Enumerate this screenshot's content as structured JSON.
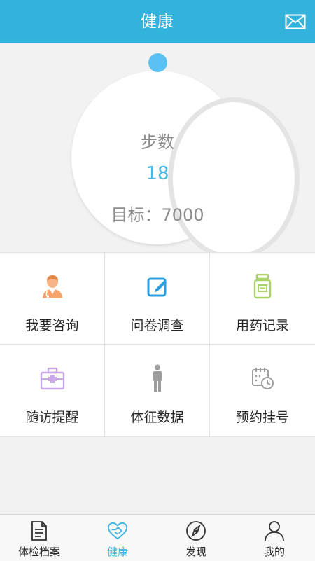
{
  "header": {
    "title": "健康",
    "mail_icon": "mail-icon"
  },
  "steps": {
    "label": "步数",
    "value": "18",
    "goal_label": "目标：7000",
    "progress_fraction": 0.0026
  },
  "grid": {
    "items": [
      {
        "label": "我要咨询",
        "icon": "doctor-icon",
        "color": "#f6a36c"
      },
      {
        "label": "问卷调查",
        "icon": "edit-note-icon",
        "color": "#2d9fe0"
      },
      {
        "label": "用药记录",
        "icon": "medicine-bottle-icon",
        "color": "#a9d267"
      },
      {
        "label": "随访提醒",
        "icon": "medical-kit-icon",
        "color": "#c8a8e6"
      },
      {
        "label": "体征数据",
        "icon": "person-icon",
        "color": "#9e9e9e"
      },
      {
        "label": "预约挂号",
        "icon": "calendar-clock-icon",
        "color": "#9e9e9e"
      }
    ]
  },
  "tabbar": {
    "items": [
      {
        "label": "体检档案",
        "icon": "document-icon"
      },
      {
        "label": "健康",
        "icon": "heart-hands-icon"
      },
      {
        "label": "发现",
        "icon": "compass-icon"
      },
      {
        "label": "我的",
        "icon": "user-icon"
      }
    ],
    "active_index": 1,
    "active_color": "#3bb5e6"
  },
  "colors": {
    "header_bg": "#31b3dc",
    "accent": "#48b7e8",
    "knob": "#5bc1f3"
  }
}
